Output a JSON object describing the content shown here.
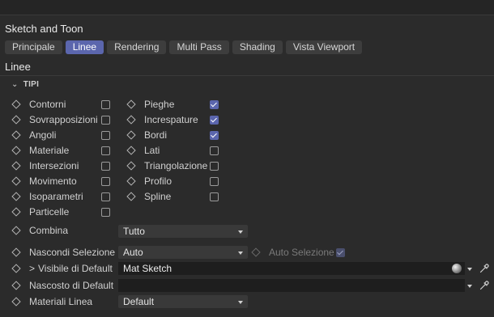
{
  "window": {
    "title": "Sketch and Toon"
  },
  "tabs": [
    {
      "label": "Principale",
      "active": false
    },
    {
      "label": "Linee",
      "active": true
    },
    {
      "label": "Rendering",
      "active": false
    },
    {
      "label": "Multi Pass",
      "active": false
    },
    {
      "label": "Shading",
      "active": false
    },
    {
      "label": "Vista Viewport",
      "active": false
    }
  ],
  "section": {
    "title": "Linee"
  },
  "group": {
    "title": "TIPI",
    "expanded": true
  },
  "line_types_left": [
    {
      "label": "Contorni",
      "checked": false
    },
    {
      "label": "Sovrapposizioni",
      "checked": false
    },
    {
      "label": "Angoli",
      "checked": false
    },
    {
      "label": "Materiale",
      "checked": false
    },
    {
      "label": "Intersezioni",
      "checked": false
    },
    {
      "label": "Movimento",
      "checked": false
    },
    {
      "label": "Isoparametri",
      "checked": false
    },
    {
      "label": "Particelle",
      "checked": false
    }
  ],
  "line_types_right": [
    {
      "label": "Pieghe",
      "checked": true
    },
    {
      "label": "Increspature",
      "checked": true
    },
    {
      "label": "Bordi",
      "checked": true
    },
    {
      "label": "Lati",
      "checked": false
    },
    {
      "label": "Triangolazione",
      "checked": false
    },
    {
      "label": "Profilo",
      "checked": false
    },
    {
      "label": "Spline",
      "checked": false
    }
  ],
  "combina": {
    "label": "Combina",
    "value": "Tutto"
  },
  "nascondi_selezione": {
    "label": "Nascondi Selezione",
    "value": "Auto"
  },
  "auto_selezione": {
    "label": "Auto Selezione",
    "checked": true,
    "enabled": false
  },
  "visibile_default": {
    "label": "Visibile di Default",
    "value": "Mat Sketch"
  },
  "nascosto_default": {
    "label": "Nascosto di Default",
    "value": ""
  },
  "materiali_linea": {
    "label": "Materiali Linea",
    "value": "Default"
  },
  "colors": {
    "accent": "#5b66ad",
    "background": "#2b2b2b",
    "field": "#1e1e1e",
    "dropdown": "#393939"
  }
}
